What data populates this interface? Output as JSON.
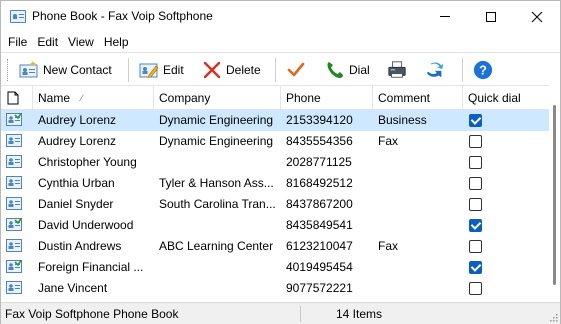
{
  "window": {
    "title": "Phone Book - Fax Voip Softphone"
  },
  "menu": [
    "File",
    "Edit",
    "View",
    "Help"
  ],
  "toolbar": {
    "new_contact": "New Contact",
    "edit": "Edit",
    "delete": "Delete",
    "dial": "Dial"
  },
  "table": {
    "columns": {
      "name": "Name",
      "company": "Company",
      "phone": "Phone",
      "comment": "Comment",
      "quick_dial": "Quick dial"
    },
    "rows": [
      {
        "name": "Audrey Lorenz",
        "company": "Dynamic Engineering",
        "phone": "2153394120",
        "comment": "Business",
        "quick": true,
        "selected": true,
        "icon": "contact-quick"
      },
      {
        "name": "Audrey Lorenz",
        "company": "Dynamic Engineering",
        "phone": "8435554356",
        "comment": "Fax",
        "quick": false,
        "selected": false,
        "icon": "contact"
      },
      {
        "name": "Christopher Young",
        "company": "",
        "phone": "2028771125",
        "comment": "",
        "quick": false,
        "selected": false,
        "icon": "contact"
      },
      {
        "name": "Cynthia Urban",
        "company": "Tyler & Hanson Ass...",
        "phone": "8168492512",
        "comment": "",
        "quick": false,
        "selected": false,
        "icon": "contact"
      },
      {
        "name": "Daniel Snyder",
        "company": "South Carolina Tran...",
        "phone": "8437867200",
        "comment": "",
        "quick": false,
        "selected": false,
        "icon": "contact"
      },
      {
        "name": "David Underwood",
        "company": "",
        "phone": "8435849541",
        "comment": "",
        "quick": true,
        "selected": false,
        "icon": "contact-quick"
      },
      {
        "name": "Dustin Andrews",
        "company": "ABC Learning Center",
        "phone": "6123210047",
        "comment": "Fax",
        "quick": false,
        "selected": false,
        "icon": "contact"
      },
      {
        "name": "Foreign Financial ...",
        "company": "",
        "phone": "4019495454",
        "comment": "",
        "quick": true,
        "selected": false,
        "icon": "contact-quick"
      },
      {
        "name": "Jane Vincent",
        "company": "",
        "phone": "9077572221",
        "comment": "",
        "quick": false,
        "selected": false,
        "icon": "contact"
      }
    ]
  },
  "status": {
    "left": "Fax Voip Softphone Phone Book",
    "right": "14 Items"
  },
  "colors": {
    "selection": "#cde8ff",
    "checkbox_on": "#0a5fc4",
    "help_blue": "#1a73d9",
    "delete_red": "#d9301f",
    "check_orange": "#e06a1a",
    "dial_green": "#1f8a1f"
  }
}
